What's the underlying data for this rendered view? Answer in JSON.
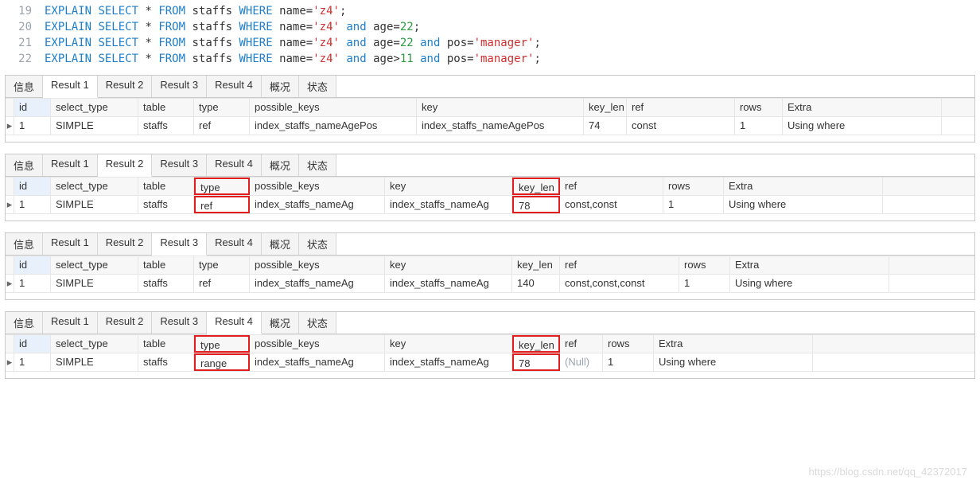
{
  "sql": {
    "lines": [
      {
        "n": 19,
        "tokens": [
          [
            "kw",
            "EXPLAIN"
          ],
          [
            "op",
            " "
          ],
          [
            "kw",
            "SELECT"
          ],
          [
            "op",
            " * "
          ],
          [
            "kw",
            "FROM"
          ],
          [
            "op",
            " staffs "
          ],
          [
            "kw",
            "WHERE"
          ],
          [
            "op",
            " name="
          ],
          [
            "str",
            "'z4'"
          ],
          [
            "op",
            ";"
          ]
        ]
      },
      {
        "n": 20,
        "tokens": [
          [
            "kw",
            "EXPLAIN"
          ],
          [
            "op",
            " "
          ],
          [
            "kw",
            "SELECT"
          ],
          [
            "op",
            " * "
          ],
          [
            "kw",
            "FROM"
          ],
          [
            "op",
            " staffs "
          ],
          [
            "kw",
            "WHERE"
          ],
          [
            "op",
            " name="
          ],
          [
            "str",
            "'z4'"
          ],
          [
            "op",
            " "
          ],
          [
            "kw",
            "and"
          ],
          [
            "op",
            " age="
          ],
          [
            "num",
            "22"
          ],
          [
            "op",
            ";"
          ]
        ]
      },
      {
        "n": 21,
        "tokens": [
          [
            "kw",
            "EXPLAIN"
          ],
          [
            "op",
            " "
          ],
          [
            "kw",
            "SELECT"
          ],
          [
            "op",
            " * "
          ],
          [
            "kw",
            "FROM"
          ],
          [
            "op",
            " staffs "
          ],
          [
            "kw",
            "WHERE"
          ],
          [
            "op",
            " name="
          ],
          [
            "str",
            "'z4'"
          ],
          [
            "op",
            " "
          ],
          [
            "kw",
            "and"
          ],
          [
            "op",
            " age="
          ],
          [
            "num",
            "22"
          ],
          [
            "op",
            " "
          ],
          [
            "kw",
            "and"
          ],
          [
            "op",
            " pos="
          ],
          [
            "str",
            "'manager'"
          ],
          [
            "op",
            ";"
          ]
        ]
      },
      {
        "n": 22,
        "tokens": [
          [
            "kw",
            "EXPLAIN"
          ],
          [
            "op",
            " "
          ],
          [
            "kw",
            "SELECT"
          ],
          [
            "op",
            " * "
          ],
          [
            "kw",
            "FROM"
          ],
          [
            "op",
            " staffs "
          ],
          [
            "kw",
            "WHERE"
          ],
          [
            "op",
            " name="
          ],
          [
            "str",
            "'z4'"
          ],
          [
            "op",
            " "
          ],
          [
            "kw",
            "and"
          ],
          [
            "op",
            " age>"
          ],
          [
            "num",
            "11"
          ],
          [
            "op",
            " "
          ],
          [
            "kw",
            "and"
          ],
          [
            "op",
            " pos="
          ],
          [
            "str",
            "'manager'"
          ],
          [
            "op",
            ";"
          ]
        ]
      }
    ]
  },
  "tabs": {
    "info": "信息",
    "r1": "Result 1",
    "r2": "Result 2",
    "r3": "Result 3",
    "r4": "Result 4",
    "profile": "概况",
    "status": "状态"
  },
  "cols": {
    "id": "id",
    "select_type": "select_type",
    "table": "table",
    "type": "type",
    "possible_keys": "possible_keys",
    "key": "key",
    "key_len": "key_len",
    "ref": "ref",
    "rows": "rows",
    "extra": "Extra"
  },
  "p1": {
    "active": "r1",
    "widths": [
      46,
      110,
      70,
      70,
      210,
      210,
      54,
      136,
      60,
      200
    ],
    "row": {
      "id": "1",
      "select_type": "SIMPLE",
      "table": "staffs",
      "type": "ref",
      "possible_keys": "index_staffs_nameAgePos",
      "key": "index_staffs_nameAgePos",
      "key_len": "74",
      "ref": "const",
      "rows": "1",
      "extra": "Using where"
    }
  },
  "p2": {
    "active": "r2",
    "widths": [
      46,
      110,
      70,
      70,
      170,
      160,
      60,
      130,
      76,
      200
    ],
    "row": {
      "id": "1",
      "select_type": "SIMPLE",
      "table": "staffs",
      "type": "ref",
      "possible_keys": "index_staffs_nameAg",
      "key": "index_staffs_nameAg",
      "key_len": "78",
      "ref": "const,const",
      "rows": "1",
      "extra": "Using where"
    },
    "red": [
      "type",
      "key_len"
    ]
  },
  "p3": {
    "active": "r3",
    "widths": [
      46,
      110,
      70,
      70,
      170,
      160,
      60,
      150,
      64,
      200
    ],
    "row": {
      "id": "1",
      "select_type": "SIMPLE",
      "table": "staffs",
      "type": "ref",
      "possible_keys": "index_staffs_nameAg",
      "key": "index_staffs_nameAg",
      "key_len": "140",
      "ref": "const,const,const",
      "rows": "1",
      "extra": "Using where"
    }
  },
  "p4": {
    "active": "r4",
    "widths": [
      46,
      110,
      70,
      70,
      170,
      160,
      60,
      54,
      64,
      200
    ],
    "row": {
      "id": "1",
      "select_type": "SIMPLE",
      "table": "staffs",
      "type": "range",
      "possible_keys": "index_staffs_nameAg",
      "key": "index_staffs_nameAg",
      "key_len": "78",
      "ref": "(Null)",
      "rows": "1",
      "extra": "Using where"
    },
    "red": [
      "type",
      "key_len"
    ]
  },
  "watermark": "https://blog.csdn.net/qq_42372017"
}
